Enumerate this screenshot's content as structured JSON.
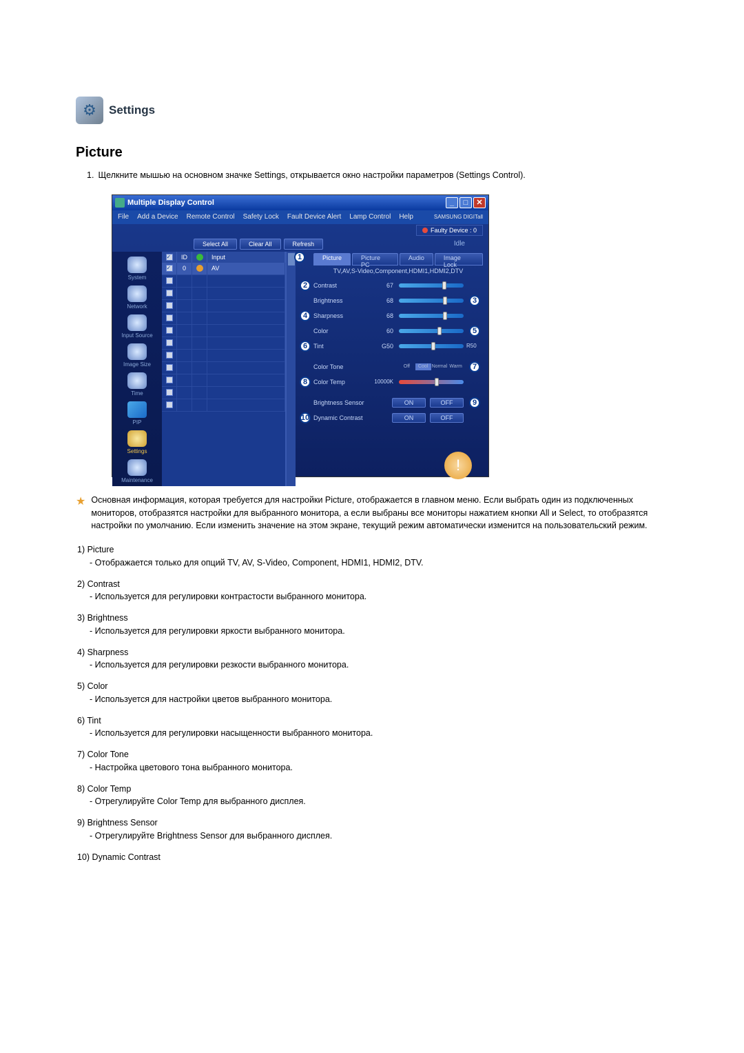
{
  "header": {
    "title": "Settings"
  },
  "section": {
    "title": "Picture"
  },
  "intro": {
    "num": "1.",
    "text": "Щелкните мышью на основном значке Settings, открывается окно настройки параметров (Settings Control)."
  },
  "window": {
    "title": "Multiple Display Control",
    "menu": [
      "File",
      "Add a Device",
      "Remote Control",
      "Safety Lock",
      "Fault Device Alert",
      "Lamp Control",
      "Help"
    ],
    "brand": "SAMSUNG DIGITall",
    "fault": "Faulty Device : 0",
    "toolbar": [
      "Select All",
      "Clear All",
      "Refresh"
    ],
    "status": "Idle",
    "sidebar": [
      {
        "label": "System"
      },
      {
        "label": "Network"
      },
      {
        "label": "Input Source"
      },
      {
        "label": "Image Size"
      },
      {
        "label": "Time"
      },
      {
        "label": "PIP"
      },
      {
        "label": "Settings"
      },
      {
        "label": "Maintenance"
      }
    ],
    "grid": {
      "headers": [
        "",
        "ID",
        "",
        "Input"
      ],
      "row": {
        "id": "0",
        "input": "AV"
      }
    },
    "tabs": [
      "Picture",
      "Picture PC",
      "Audio",
      "Image Lock"
    ],
    "source": "TV,AV,S-Video,Component,HDMI1,HDMI2,DTV",
    "controls": {
      "contrast": {
        "label": "Contrast",
        "val": "67"
      },
      "brightness": {
        "label": "Brightness",
        "val": "68"
      },
      "sharpness": {
        "label": "Sharpness",
        "val": "68"
      },
      "color": {
        "label": "Color",
        "val": "60"
      },
      "tint": {
        "label": "Tint",
        "left": "G50",
        "right": "R50"
      },
      "colortone": {
        "label": "Color Tone",
        "opts": [
          "Off",
          "Cool",
          "Normal",
          "Warm"
        ]
      },
      "colortemp": {
        "label": "Color Temp",
        "val": "10000K"
      },
      "bs": {
        "label": "Brightness Sensor",
        "on": "ON",
        "off": "OFF"
      },
      "dc": {
        "label": "Dynamic Contrast",
        "on": "ON",
        "off": "OFF"
      }
    }
  },
  "note": "Основная информация, которая требуется для настройки Picture, отображается в главном меню. Если выбрать один из подключенных мониторов, отобразятся настройки для выбранного монитора, а если выбраны все мониторы нажатием кнопки All и Select, то отобразятся настройки по умолчанию. Если изменить значение на этом экране, текущий режим автоматически изменится на пользовательский режим.",
  "defs": [
    {
      "n": "1)",
      "t": "Picture",
      "d": "- Отображается только для опций TV, AV, S-Video, Component, HDMI1, HDMI2, DTV."
    },
    {
      "n": "2)",
      "t": "Contrast",
      "d": "- Используется для регулировки контрастости выбранного монитора."
    },
    {
      "n": "3)",
      "t": "Brightness",
      "d": "- Используется для регулировки яркости выбранного монитора."
    },
    {
      "n": "4)",
      "t": "Sharpness",
      "d": "- Используется для регулировки резкости выбранного монитора."
    },
    {
      "n": "5)",
      "t": "Color",
      "d": "- Используется для настройки цветов выбранного монитора."
    },
    {
      "n": "6)",
      "t": "Tint",
      "d": "- Используется для регулировки насыщенности выбранного монитора."
    },
    {
      "n": "7)",
      "t": "Color Tone",
      "d": "- Настройка цветового тона выбранного монитора."
    },
    {
      "n": "8)",
      "t": "Color Temp",
      "d": "- Отрегулируйте Color Temp для выбранного дисплея."
    },
    {
      "n": "9)",
      "t": "Brightness Sensor",
      "d": "- Отрегулируйте Brightness Sensor для выбранного дисплея."
    },
    {
      "n": "10)",
      "t": "Dynamic Contrast",
      "d": ""
    }
  ]
}
